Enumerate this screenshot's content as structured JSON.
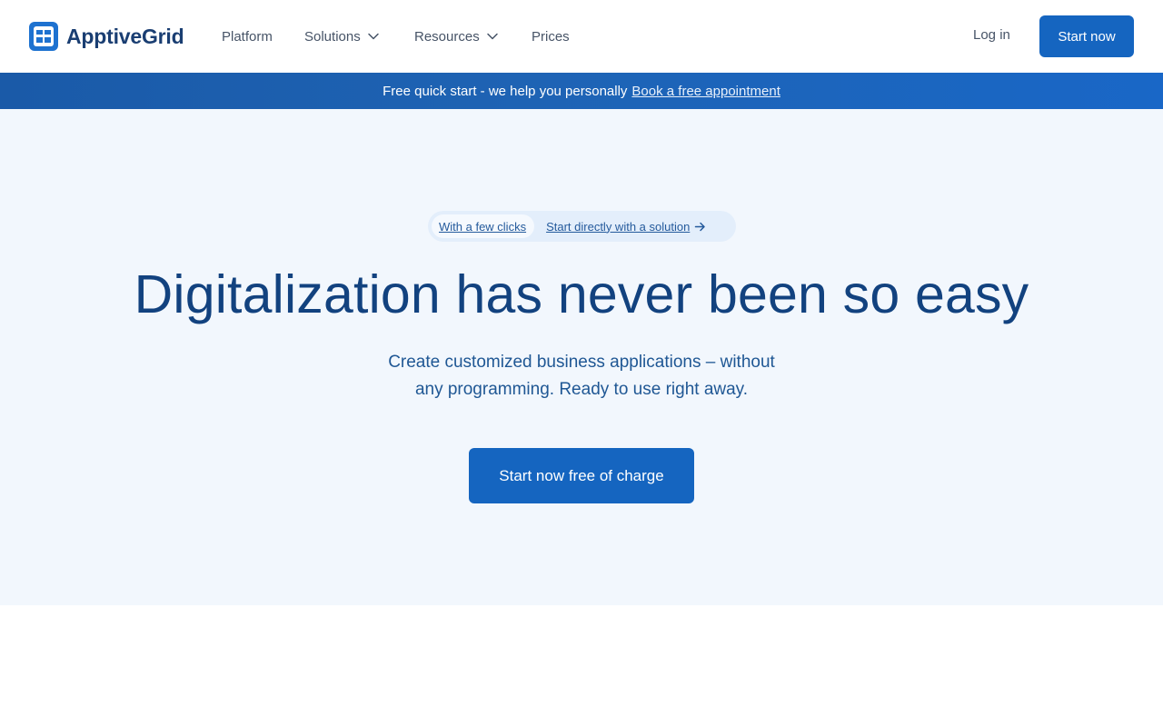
{
  "brand": {
    "name": "ApptiveGrid",
    "icon": "grid-logo-icon",
    "color": "#1a3e72"
  },
  "nav": {
    "items": [
      {
        "label": "Platform",
        "dropdown": false
      },
      {
        "label": "Solutions",
        "dropdown": true
      },
      {
        "label": "Resources",
        "dropdown": true
      },
      {
        "label": "Prices",
        "dropdown": false
      }
    ],
    "login_label": "Log in",
    "start_label": "Start now"
  },
  "banner": {
    "text": "Free quick start - we help you personally",
    "link": "Book a free appointment"
  },
  "hero": {
    "pill_tag": "With a few clicks",
    "pill_link": "Start directly with a solution",
    "headline": "Digitalization has never been so easy",
    "subline_1": "Create customized business applications – without",
    "subline_2": "any programming. Ready to use right away.",
    "cta": "Start now free of charge"
  },
  "colors": {
    "primary": "#1565c0",
    "hero_bg": "#f2f7fd",
    "headline": "#12427f"
  }
}
